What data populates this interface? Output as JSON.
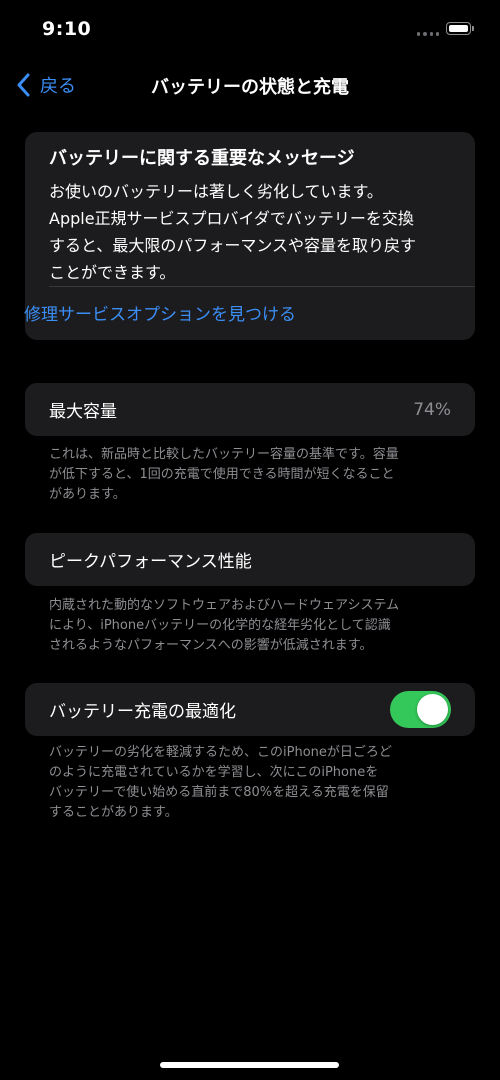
{
  "status_bar": {
    "time": "9:10"
  },
  "nav": {
    "back_label": "戻る",
    "title": "バッテリーの状態と充電"
  },
  "message": {
    "title": "バッテリーに関する重要なメッセージ",
    "body_lines": [
      "お使いのバッテリーは著しく劣化しています。",
      "Apple正規サービスプロバイダでバッテリーを交換",
      "すると、最大限のパフォーマンスや容量を取り戻す",
      "ことができます。"
    ],
    "link": "修理サービスオプションを見つける"
  },
  "max_capacity": {
    "label": "最大容量",
    "value": "74%",
    "footnote_lines": [
      "これは、新品時と比較したバッテリー容量の基準です。容量",
      "が低下すると、1回の充電で使用できる時間が短くなること",
      "があります。"
    ]
  },
  "peak_performance": {
    "label": "ピークパフォーマンス性能",
    "footnote_lines": [
      "内蔵された動的なソフトウェアおよびハードウェアシステム",
      "により、iPhoneバッテリーの化学的な経年劣化として認識",
      "されるようなパフォーマンスへの影響が低減されます。"
    ]
  },
  "optimized_charging": {
    "label": "バッテリー充電の最適化",
    "enabled": true,
    "footnote_lines": [
      "バッテリーの劣化を軽減するため、このiPhoneが日ごろど",
      "のように充電されているかを学習し、次にこのiPhoneを",
      "バッテリーで使い始める直前まで80%を超える充電を保留",
      "することがあります。"
    ]
  },
  "colors": {
    "background": "#000000",
    "card": "#1c1c1e",
    "accent_blue": "#3b8ef5",
    "toggle_on": "#34c759",
    "secondary_text": "#8e8e93"
  },
  "icons": {
    "back": "chevron-left-icon",
    "signal": "cellular-signal-icon",
    "battery": "battery-icon"
  }
}
